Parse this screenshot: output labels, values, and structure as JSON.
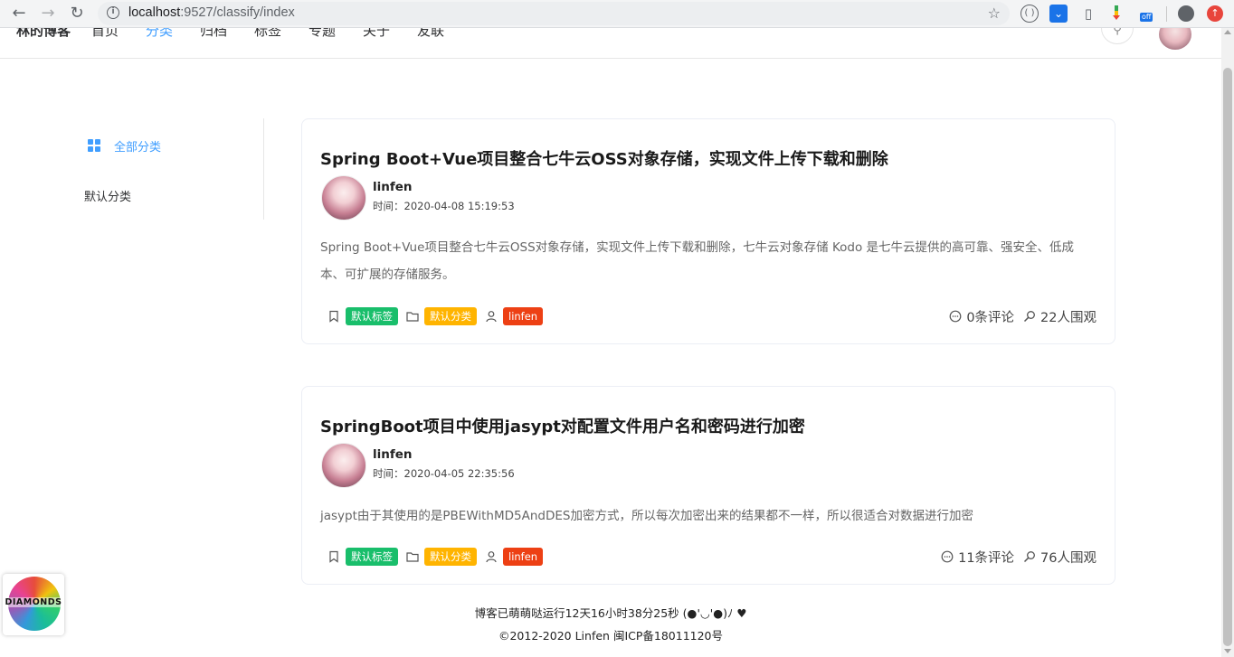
{
  "browser": {
    "url_host": "localhost",
    "url_path": ":9527/classify/index",
    "ext5_badge": "off"
  },
  "header": {
    "brand": "林的博客",
    "menu": [
      "首页",
      "分类",
      "归档",
      "标签",
      "专题",
      "关于",
      "友联"
    ],
    "active_index": 1
  },
  "category_menu": {
    "all_label": "全部分类",
    "default_label": "默认分类"
  },
  "articles": [
    {
      "title": "Spring Boot+Vue项目整合七牛云OSS对象存储，实现文件上传下载和删除",
      "author": "linfen",
      "time": "时间：2020-04-08 15:19:53",
      "summary": "Spring Boot+Vue项目整合七牛云OSS对象存储，实现文件上传下载和删除，七牛云对象存储 Kodo 是七牛云提供的高可靠、强安全、低成本、可扩展的存储服务。",
      "tag": "默认标签",
      "category": "默认分类",
      "user_tag": "linfen",
      "comments": "0条评论",
      "views": "22人围观"
    },
    {
      "title": "SpringBoot项目中使用jasypt对配置文件用户名和密码进行加密",
      "author": "linfen",
      "time": "时间：2020-04-05 22:35:56",
      "summary": "jasypt由于其使用的是PBEWithMD5AndDES加密方式，所以每次加密出来的结果都不一样，所以很适合对数据进行加密",
      "tag": "默认标签",
      "category": "默认分类",
      "user_tag": "linfen",
      "comments": "11条评论",
      "views": "76人围观"
    }
  ],
  "footer": {
    "runtime": "博客已萌萌哒运行12天16小时38分25秒 (●'◡'●)ﾉ ♥",
    "copyright": "©2012-2020 Linfen 闽ICP备18011120号"
  },
  "float_badge": {
    "text": "DIAMONDS"
  },
  "colors": {
    "accent": "#409eff",
    "tag_green": "#19be6b",
    "tag_yellow": "#ffb400",
    "tag_red": "#ed4014"
  }
}
